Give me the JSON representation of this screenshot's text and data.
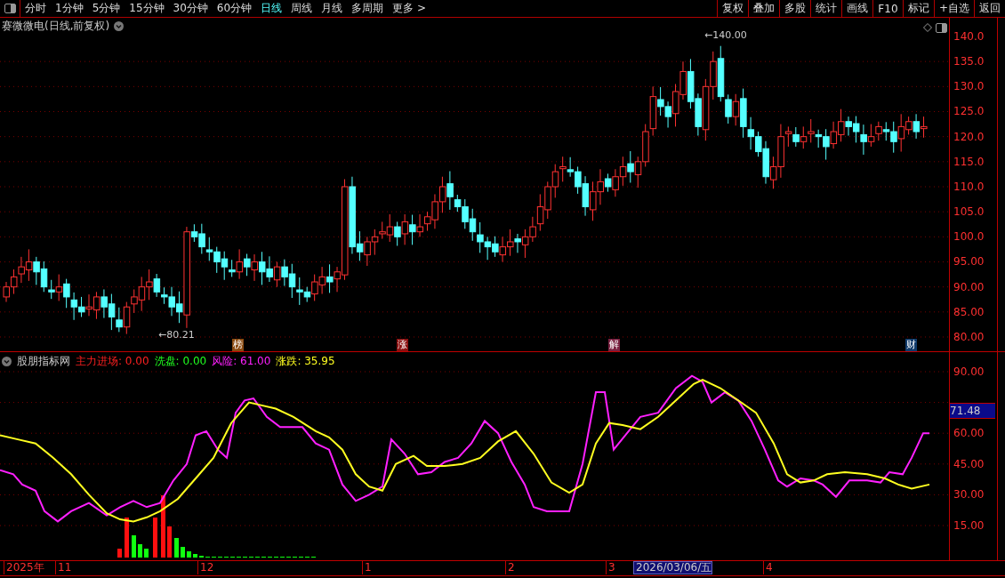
{
  "toolbar": {
    "periods": [
      {
        "label": "分时",
        "selected": false
      },
      {
        "label": "1分钟",
        "selected": false
      },
      {
        "label": "5分钟",
        "selected": false
      },
      {
        "label": "15分钟",
        "selected": false
      },
      {
        "label": "30分钟",
        "selected": false
      },
      {
        "label": "60分钟",
        "selected": false
      },
      {
        "label": "日线",
        "selected": true
      },
      {
        "label": "周线",
        "selected": false
      },
      {
        "label": "月线",
        "selected": false
      },
      {
        "label": "多周期",
        "selected": false
      },
      {
        "label": "更多 >",
        "selected": false
      }
    ],
    "buttons": [
      "复权",
      "叠加",
      "多股",
      "统计",
      "画线",
      "F10",
      "标记",
      "+自选",
      "返回"
    ]
  },
  "stock_title": "赛微微电(日线,前复权)",
  "price_axis": {
    "ticks": [
      "140.0",
      "135.0",
      "130.0",
      "125.0",
      "120.0",
      "115.0",
      "110.0",
      "105.0",
      "100.0",
      "95.00",
      "90.00",
      "85.00",
      "80.00"
    ]
  },
  "price_marks": [
    "←140.00",
    "←80.21"
  ],
  "event_tags": [
    {
      "label": "榜",
      "color": "#8a4a10"
    },
    {
      "label": "涨",
      "color": "#8a1010"
    },
    {
      "label": "解",
      "color": "#7a2040"
    },
    {
      "label": "财",
      "color": "#103a6a"
    }
  ],
  "indicator": {
    "name": "股朋指标网",
    "values": [
      {
        "label": "主力进场:",
        "value": "0.00",
        "color": "#ff2020"
      },
      {
        "label": "洗盘:",
        "value": "0.00",
        "color": "#20ff20"
      },
      {
        "label": "风险:",
        "value": "61.00",
        "color": "#ff20ff"
      },
      {
        "label": "涨跌:",
        "value": "35.95",
        "color": "#ffff20"
      }
    ],
    "axis_ticks": [
      "90.00",
      "60.00",
      "45.00",
      "30.00",
      "15.00"
    ],
    "current_value": "71.48"
  },
  "time_axis": {
    "labels": [
      {
        "label": "2025年",
        "selected": false
      },
      {
        "label": "11",
        "selected": false
      },
      {
        "label": "12",
        "selected": false
      },
      {
        "label": "1",
        "selected": false
      },
      {
        "label": "2",
        "selected": false
      },
      {
        "label": "3",
        "selected": false
      },
      {
        "label": "2026/03/06/五",
        "selected": true
      },
      {
        "label": "4",
        "selected": false
      }
    ]
  }
}
